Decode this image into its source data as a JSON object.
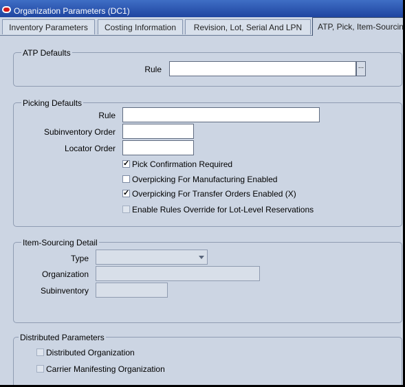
{
  "window": {
    "title": "Organization Parameters (DC1)"
  },
  "tabs": [
    {
      "label": "Inventory Parameters"
    },
    {
      "label": "Costing Information"
    },
    {
      "label": "Revision, Lot, Serial And LPN"
    },
    {
      "label": "ATP, Pick, Item-Sourcing"
    }
  ],
  "atp_defaults": {
    "legend": "ATP Defaults",
    "rule_label": "Rule",
    "rule_value": "",
    "lov_button": "..."
  },
  "picking_defaults": {
    "legend": "Picking Defaults",
    "rule_label": "Rule",
    "rule_value": "",
    "subinventory_order_label": "Subinventory Order",
    "subinventory_order_value": "",
    "locator_order_label": "Locator Order",
    "locator_order_value": "",
    "checkboxes": [
      {
        "label": "Pick Confirmation Required",
        "checked": true,
        "enabled": true
      },
      {
        "label": "Overpicking For Manufacturing Enabled",
        "checked": false,
        "enabled": true
      },
      {
        "label": "Overpicking For Transfer Orders Enabled (X)",
        "checked": true,
        "enabled": true
      },
      {
        "label": "Enable Rules Override for Lot-Level Reservations",
        "checked": false,
        "enabled": false
      }
    ]
  },
  "item_sourcing": {
    "legend": "Item-Sourcing Detail",
    "type_label": "Type",
    "type_value": "",
    "organization_label": "Organization",
    "organization_value": "",
    "subinventory_label": "Subinventory",
    "subinventory_value": ""
  },
  "distributed": {
    "legend": "Distributed Parameters",
    "checkboxes": [
      {
        "label": "Distributed Organization",
        "checked": false,
        "enabled": false
      },
      {
        "label": "Carrier Manifesting Organization",
        "checked": false,
        "enabled": false
      }
    ]
  },
  "icons": {
    "logo": "oracle-logo-icon",
    "lov": "ellipsis-icon",
    "dropdown": "chevron-down-icon",
    "check": "checkmark-icon"
  },
  "colors": {
    "titlebar": "#2a55b5",
    "canvas": "#ccd5e3",
    "field": "#ffffff"
  }
}
